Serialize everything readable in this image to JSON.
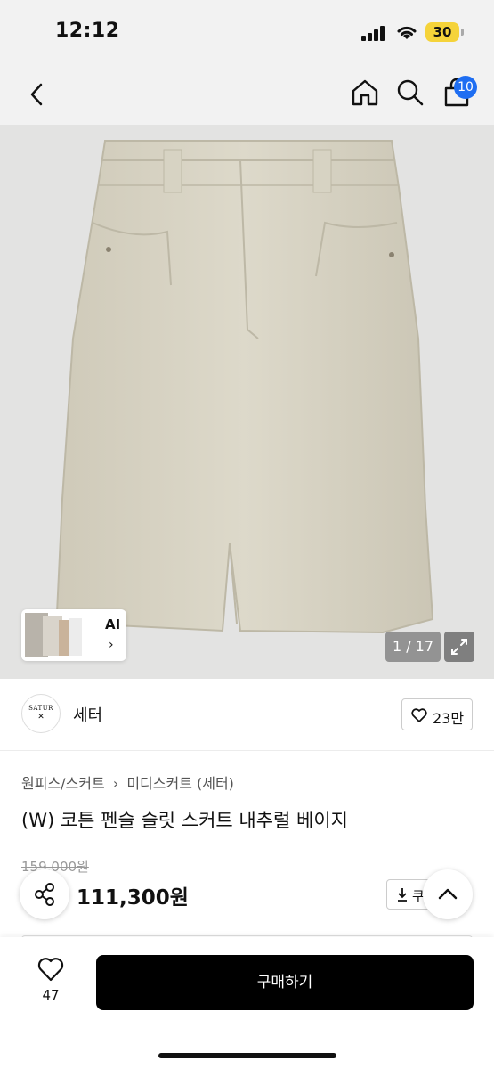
{
  "status_bar": {
    "time": "12:12",
    "battery": "30"
  },
  "nav": {
    "cart_badge": "10"
  },
  "gallery": {
    "counter": "1 / 17",
    "ai_label": "AI",
    "ai_chevron": "›"
  },
  "brand": {
    "logo_line1": "SATUR",
    "logo_line2": "✕",
    "name": "세터",
    "likes": "23만"
  },
  "breadcrumb": [
    "원피스/스커트",
    "›",
    "미디스커트 (세터)"
  ],
  "product": {
    "title": "(W) 코튼 펜슬 슬릿 스커트 내추럴 베이지",
    "original_price": "159,000원",
    "price": "111,300원"
  },
  "coupon_label": "쿠",
  "bottom_bar": {
    "wish_count": "47",
    "buy_label": "구매하기"
  },
  "colors": {
    "accent_blue": "#1f6ef2",
    "battery_yellow": "#f5d33a",
    "skirt": "#d8d4c4",
    "background_gray": "#e3e3e2"
  }
}
